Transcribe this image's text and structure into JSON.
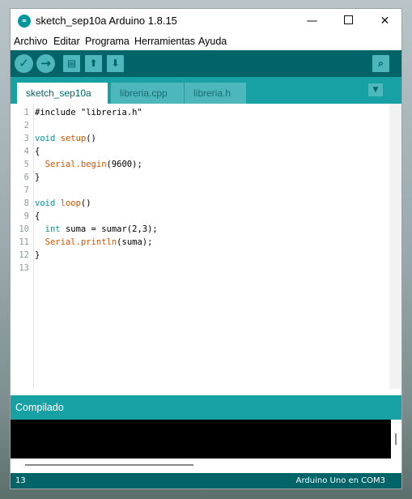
{
  "window": {
    "title": "sketch_sep10a Arduino 1.8.15",
    "icon_name": "arduino-logo-icon",
    "controls": {
      "minimize": "—",
      "maximize": "",
      "close": "✕"
    }
  },
  "menu": [
    "Archivo",
    "Editar",
    "Programa",
    "Herramientas",
    "Ayuda"
  ],
  "toolbar": {
    "verify_icon": "✓",
    "upload_icon": "→",
    "new_icon": "▤",
    "open_icon": "⬆",
    "save_icon": "⬇",
    "serial_icon": "⌕"
  },
  "tabs": [
    {
      "label": "sketch_sep10a §"
    },
    {
      "label": "libreria.cpp §"
    },
    {
      "label": "libreria.h §"
    }
  ],
  "tab_menu_icon": "▼",
  "editor": {
    "lines": [
      "1",
      "2",
      "3",
      "4",
      "5",
      "6",
      "7",
      "8",
      "9",
      "10",
      "11",
      "12",
      "13"
    ],
    "code": {
      "l1": "#include \"libreria.h\"",
      "l3_kw": "void",
      "l3_fn": "setup",
      "l3_rest": "()",
      "l4": "{",
      "l5_fn": "Serial.begin",
      "l5_rest": "(9600);",
      "l6": "}",
      "l8_kw": "void",
      "l8_fn": "loop",
      "l8_rest": "()",
      "l9": "{",
      "l10_kw": "int",
      "l10_rest": " suma = sumar(2,3);",
      "l11_fn": "Serial.println",
      "l11_rest": "(suma);",
      "l12": "}"
    }
  },
  "console": {
    "label": "Compilado"
  },
  "status": {
    "line": "13",
    "board": "Arduino Uno en COM3"
  },
  "colors": {
    "toolbar": "#006468",
    "tabs": "#17a1a5",
    "accent": "#4db7bb",
    "keyword": "#00979c",
    "function": "#d35400"
  }
}
